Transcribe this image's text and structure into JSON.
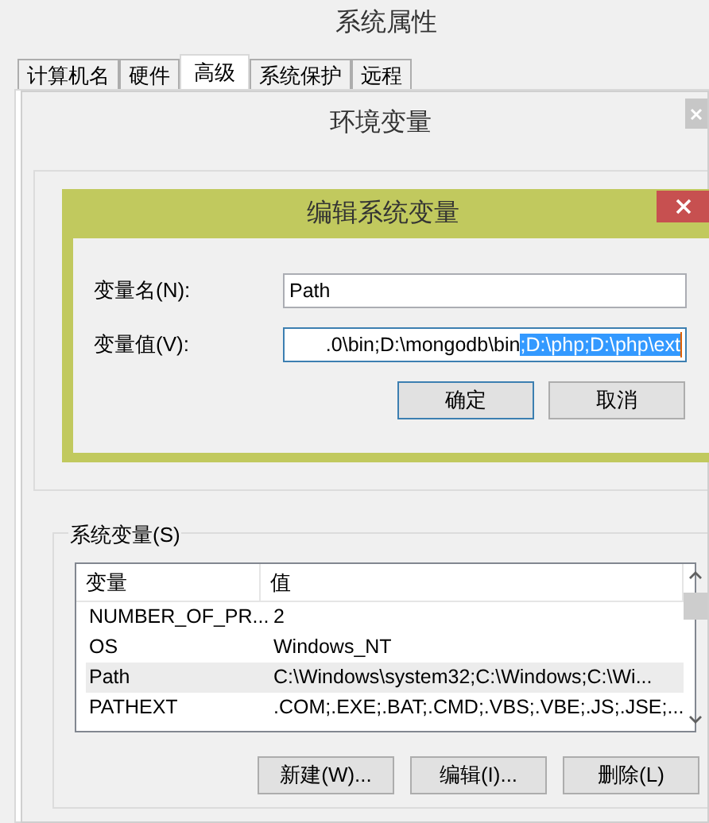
{
  "window": {
    "title": "系统属性"
  },
  "tabs": [
    {
      "label": "计算机名",
      "selected": false
    },
    {
      "label": "硬件",
      "selected": false
    },
    {
      "label": "高级",
      "selected": true
    },
    {
      "label": "系统保护",
      "selected": false
    },
    {
      "label": "远程",
      "selected": false
    }
  ],
  "env_dialog": {
    "title": "环境变量",
    "system_variables": {
      "label": "系统变量(S)",
      "columns": [
        "变量",
        "值"
      ],
      "rows": [
        {
          "name": "NUMBER_OF_PR...",
          "value": "2",
          "selected": false
        },
        {
          "name": "OS",
          "value": "Windows_NT",
          "selected": false
        },
        {
          "name": "Path",
          "value": "C:\\Windows\\system32;C:\\Windows;C:\\Wi...",
          "selected": true
        },
        {
          "name": "PATHEXT",
          "value": ".COM;.EXE;.BAT;.CMD;.VBS;.VBE;.JS;.JSE;...",
          "selected": false
        }
      ]
    },
    "buttons": [
      "新建(W)...",
      "编辑(I)...",
      "删除(L)"
    ]
  },
  "edit_dialog": {
    "title": "编辑系统变量",
    "fields": [
      {
        "label": "变量名(N):",
        "value": "Path",
        "focused": false
      },
      {
        "label": "变量值(V):",
        "value": ".0\\bin;D:\\mongodb\\bin",
        "selected_text": ";D:\\php;D:\\php\\ext",
        "focused": true
      }
    ],
    "buttons": [
      {
        "label": "确定",
        "default": true
      },
      {
        "label": "取消",
        "default": false
      }
    ]
  }
}
